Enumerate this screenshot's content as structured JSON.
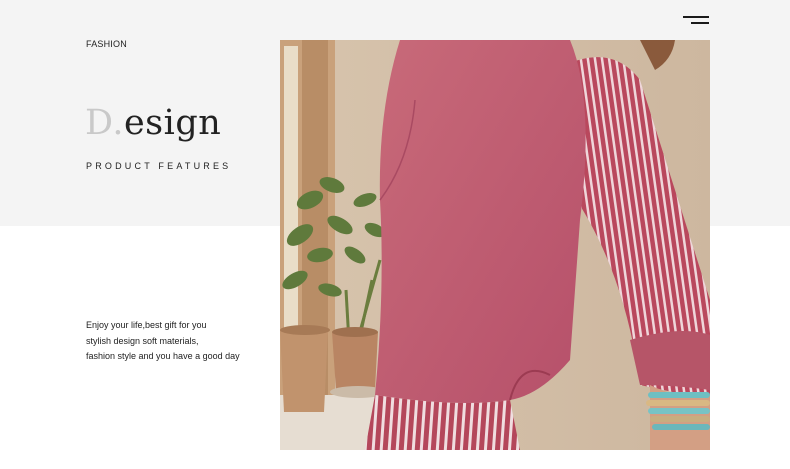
{
  "header": {
    "tag": "FASHION",
    "menu_icon": "hamburger-menu-icon"
  },
  "hero": {
    "title_initial": "D.",
    "title_rest": "esign",
    "subtitle": "PRODUCT FEATURES"
  },
  "description": {
    "lines": [
      "Enjoy your life,best gift for you",
      "stylish design soft materials,",
      "fashion style and you have a good day"
    ]
  },
  "colors": {
    "band": "#f4f4f4",
    "sweater": "#c25a6c",
    "stripe_base": "#b44a5e"
  }
}
